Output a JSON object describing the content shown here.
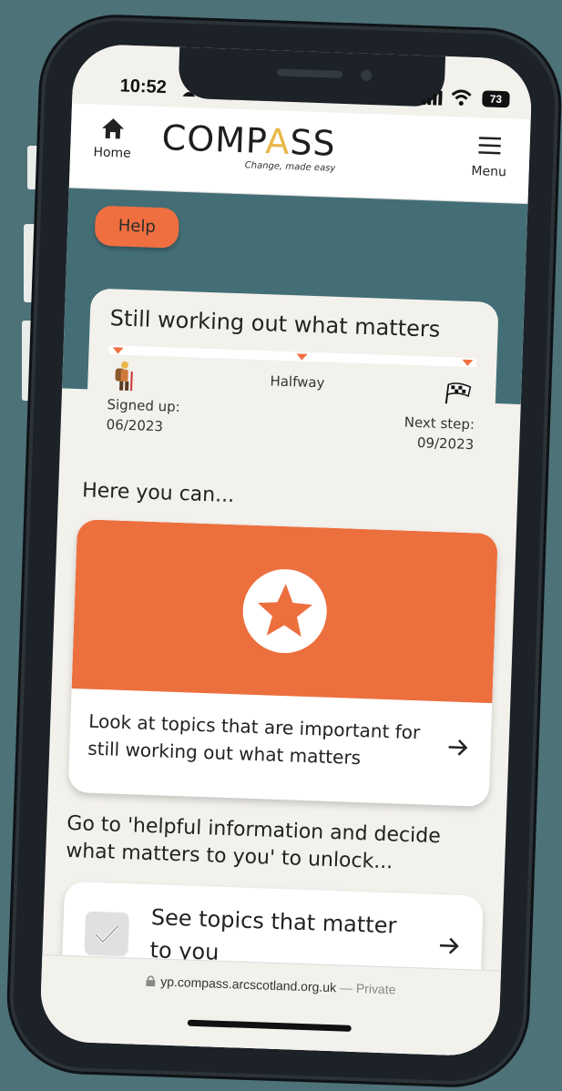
{
  "status_bar": {
    "time": "10:52",
    "battery": "73"
  },
  "header": {
    "home_label": "Home",
    "logo_text_left": "COMP",
    "logo_text_accent": "A",
    "logo_text_right": "SS",
    "tagline": "Change, made easy",
    "menu_label": "Menu"
  },
  "help_label": "Help",
  "progress": {
    "title": "Still working out what matters",
    "milestone_middle": "Halfway",
    "start_label": "Signed up:",
    "start_date": "06/2023",
    "end_label": "Next step:",
    "end_date": "09/2023"
  },
  "here_heading": "Here you can...",
  "topic_card": {
    "text": "Look at topics that are important for still working out what matters",
    "accent_color": "#ec6f3e"
  },
  "unlock_heading": "Go to 'helpful information and decide what matters to you' to unlock...",
  "locked_card": {
    "text": "See topics that matter to you"
  },
  "browser": {
    "url": "yp.compass.arcscotland.org.uk",
    "separator": " — ",
    "mode": "Private"
  },
  "colors": {
    "teal": "#436e75",
    "orange": "#ef6f40",
    "logo_accent": "#e8b74a"
  }
}
